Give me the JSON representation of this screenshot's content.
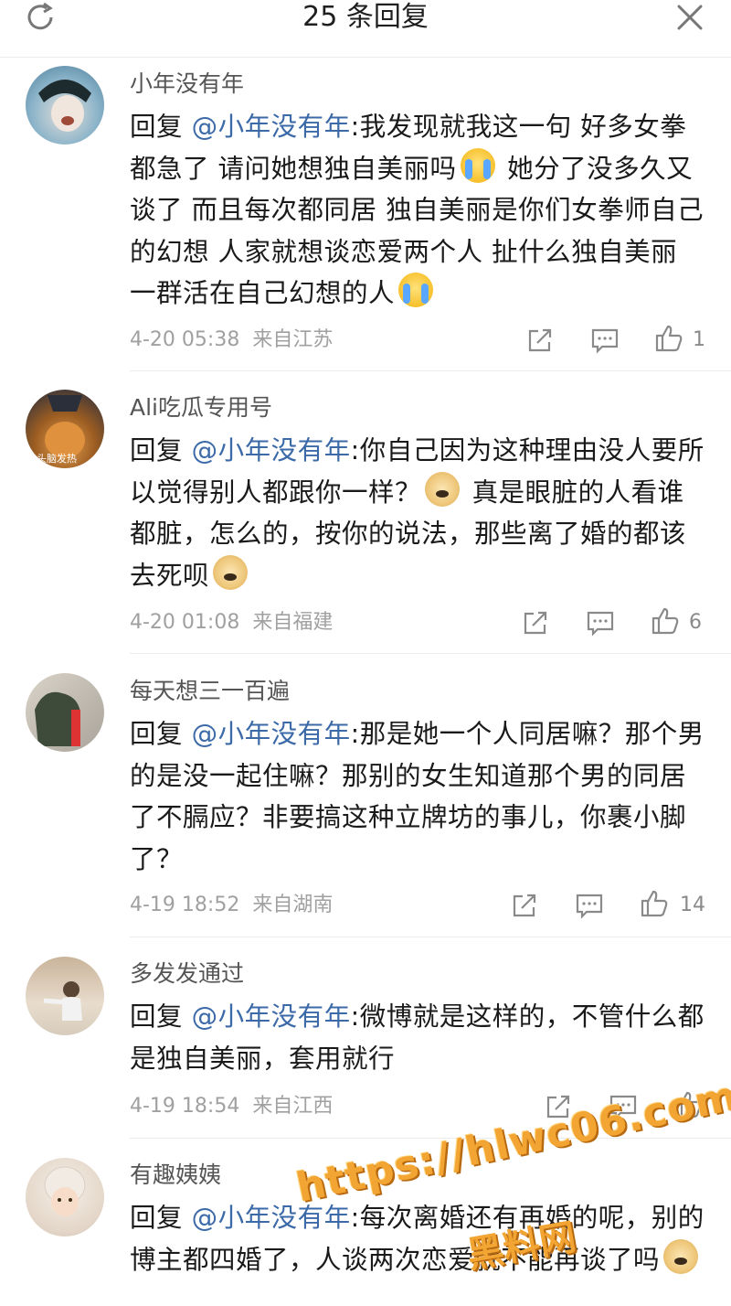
{
  "header": {
    "title": "25 条回复"
  },
  "comments": [
    {
      "username": "小年没有年",
      "reply_prefix": "回复",
      "mention": "@小年没有年",
      "segments": [
        ":我发现就我这一句 好多女拳都急了 请问她想独自美丽吗",
        " 她分了没多久又谈了 而且每次都同居 独自美丽是你们女拳师自己的幻想 人家就想谈恋爱两个人 扯什么独自美丽 一群活在自己幻想的人"
      ],
      "time": "4-20 05:38",
      "location": "来自江苏",
      "likes": "1"
    },
    {
      "username": "Ali吃瓜专用号",
      "avatar_caption": "头脑发热",
      "reply_prefix": "回复",
      "mention": "@小年没有年",
      "segments": [
        ":你自己因为这种理由没人要所以觉得别人都跟你一样？",
        " 真是眼脏的人看谁都脏，怎么的，按你的说法，那些离了婚的都该去死呗"
      ],
      "time": "4-20 01:08",
      "location": "来自福建",
      "likes": "6"
    },
    {
      "username": "每天想三一百遍",
      "reply_prefix": "回复",
      "mention": "@小年没有年",
      "text": ":那是她一个人同居嘛？那个男的是没一起住嘛？那别的女生知道那个男的同居了不膈应？非要搞这种立牌坊的事儿，你裹小脚了？",
      "time": "4-19 18:52",
      "location": "来自湖南",
      "likes": "14"
    },
    {
      "username": "多发发通过",
      "reply_prefix": "回复",
      "mention": "@小年没有年",
      "text": ":微博就是这样的，不管什么都是独自美丽，套用就行",
      "time": "4-19 18:54",
      "location": "来自江西",
      "likes": ""
    },
    {
      "username": "有趣姨姨",
      "reply_prefix": "回复",
      "mention": "@小年没有年",
      "text": ":每次离婚还有再婚的呢，别的博主都四婚了，人谈两次恋爱就不能再谈了吗",
      "time": "",
      "location": "",
      "likes": ""
    }
  ],
  "watermark": {
    "url": "https://hlwc06.com",
    "brand": "黑料网"
  },
  "colors": {
    "mention": "#3c6aa8",
    "meta": "#a0a0a0",
    "divider": "#ececec",
    "watermark": "#f2a532"
  },
  "icons": [
    "refresh-icon",
    "close-icon",
    "share-icon",
    "comment-icon",
    "like-icon"
  ]
}
